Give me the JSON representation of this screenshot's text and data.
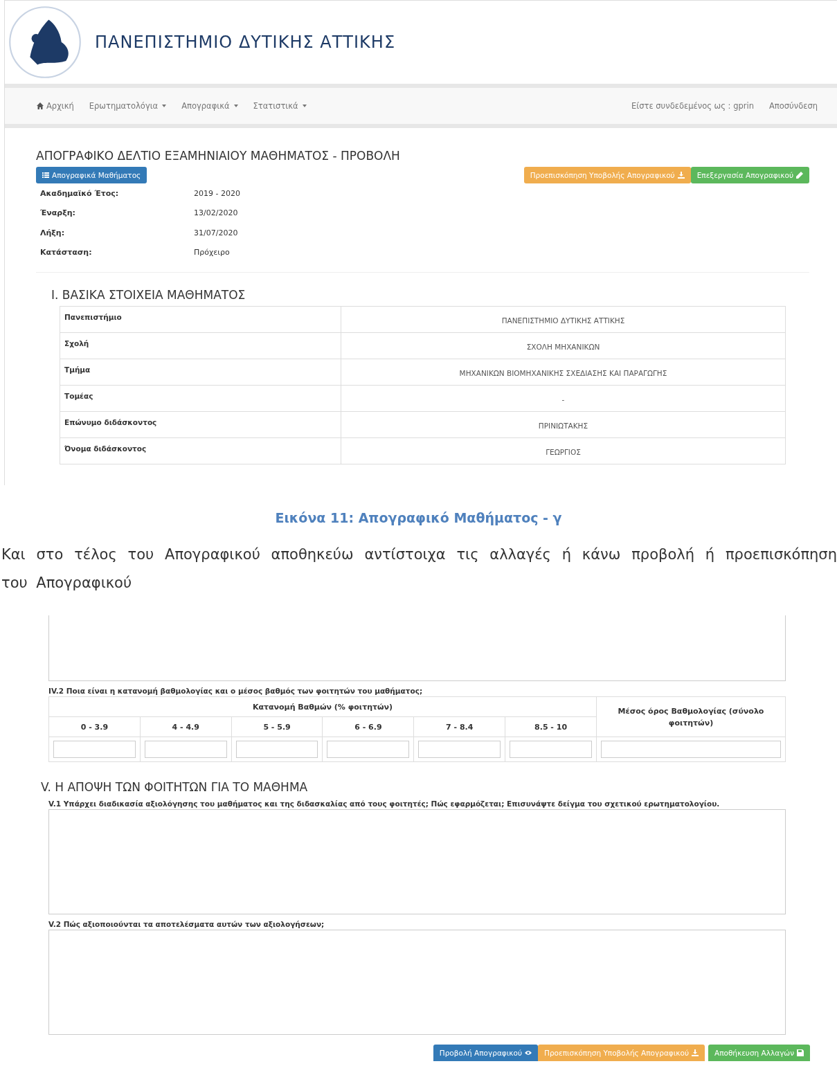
{
  "screenshot_1": {
    "header": {
      "title": "ΠΑΝΕΠΙΣΤΗΜΙΟ ΔΥΤΙΚΗΣ ΑΤΤΙΚΗΣ"
    },
    "nav": {
      "items": [
        {
          "label": "Αρχική",
          "kind": "home"
        },
        {
          "label": "Ερωτηματολόγια",
          "kind": "menu"
        },
        {
          "label": "Απογραφικά",
          "kind": "menu"
        },
        {
          "label": "Στατιστικά",
          "kind": "menu"
        }
      ],
      "user": "Είστε συνδεδεμένος ως : gprin",
      "logout": "Αποσύνδεση"
    },
    "page_title": "ΑΠΟΓΡΑΦΙΚΟ ΔΕΛΤΙΟ ΕΞΑΜΗΝΙΑΙΟΥ ΜΑΘΗΜΑΤΟΣ - ΠΡΟΒΟΛΗ",
    "left_button": {
      "label": "Απογραφικά Μαθήματος",
      "kind": "list"
    },
    "right_buttons": [
      {
        "label": "Προεπισκόπηση Υποβολής Απογραφικού",
        "kind": "download"
      },
      {
        "label": "Επεξεργασία Απογραφικού",
        "kind": "edit"
      }
    ],
    "details": [
      {
        "label": "Ακαδημαϊκό Έτος:",
        "value": "2019 - 2020"
      },
      {
        "label": "Έναρξη:",
        "value": "13/02/2020"
      },
      {
        "label": "Λήξη:",
        "value": "31/07/2020"
      },
      {
        "label": "Κατάσταση:",
        "value": "Πρόχειρο"
      }
    ],
    "section_title": "I. ΒΑΣΙΚΑ ΣΤΟΙΧΕΙΑ ΜΑΘΗΜΑΤΟΣ",
    "table": {
      "rows": [
        {
          "label": "Πανεπιστήμιο",
          "value": "ΠΑΝΕΠΙΣΤΗΜΙΟ ΔΥΤΙΚΗΣ ΑΤΤΙΚΗΣ"
        },
        {
          "label": "Σχολή",
          "value": "ΣΧΟΛΗ ΜΗΧΑΝΙΚΩΝ"
        },
        {
          "label": "Τμήμα",
          "value": "ΜΗΧΑΝΙΚΩΝ ΒΙΟΜΗΧΑΝΙΚΗΣ ΣΧΕΔΙΑΣΗΣ ΚΑΙ ΠΑΡΑΓΩΓΗΣ"
        },
        {
          "label": "Τομέας",
          "value": "-"
        },
        {
          "label": "Επώνυμο διδάσκοντος",
          "value": "ΠΡΙΝΙΩΤΑΚΗΣ"
        },
        {
          "label": "Όνομα διδάσκοντος",
          "value": "ΓΕΩΡΓΙΟΣ"
        }
      ]
    }
  },
  "caption": "Εικόνα 11: Απογραφικό Μαθήματος - γ",
  "paragraph": "Και στο τέλος του Απογραφικού αποθηκεύω αντίστοιχα τις αλλαγές ή κάνω προβολή ή προεπισκόπηση του Απογραφικού",
  "screenshot_2": {
    "question_iv2": "IV.2 Ποια είναι η κατανομή βαθμολογίας και ο μέσος βαθμός των φοιτητών του μαθήματος;",
    "grades_table": {
      "group_header": "Κατανομή Βαθμών (% φοιτητών)",
      "columns": [
        "0 - 3.9",
        "4 - 4.9",
        "5 - 5.9",
        "6 - 6.9",
        "7 - 8.4",
        "8.5 - 10"
      ],
      "average_header": "Μέσος όρος Βαθμολογίας (σύνολο φοιτητών)"
    },
    "section_title": "V. Η ΑΠΟΨΗ ΤΩΝ ΦΟΙΤΗΤΩΝ ΓΙΑ ΤΟ ΜΑΘΗΜΑ",
    "questions": [
      "V.1 Υπάρχει διαδικασία αξιολόγησης του μαθήματος και της διδασκαλίας από τους φοιτητές; Πώς εφαρμόζεται; Επισυνάψτε δείγμα του σχετικού ερωτηματολογίου.",
      "V.2 Πώς αξιοποιούνται τα αποτελέσματα αυτών των αξιολογήσεων;"
    ],
    "buttons": [
      {
        "label": "Προβολή Απογραφικού",
        "kind": "view"
      },
      {
        "label": "Προεπισκόπηση Υποβολής Απογραφικού",
        "kind": "download"
      },
      {
        "label": "Αποθήκευση Αλλαγών",
        "kind": "save"
      }
    ]
  }
}
